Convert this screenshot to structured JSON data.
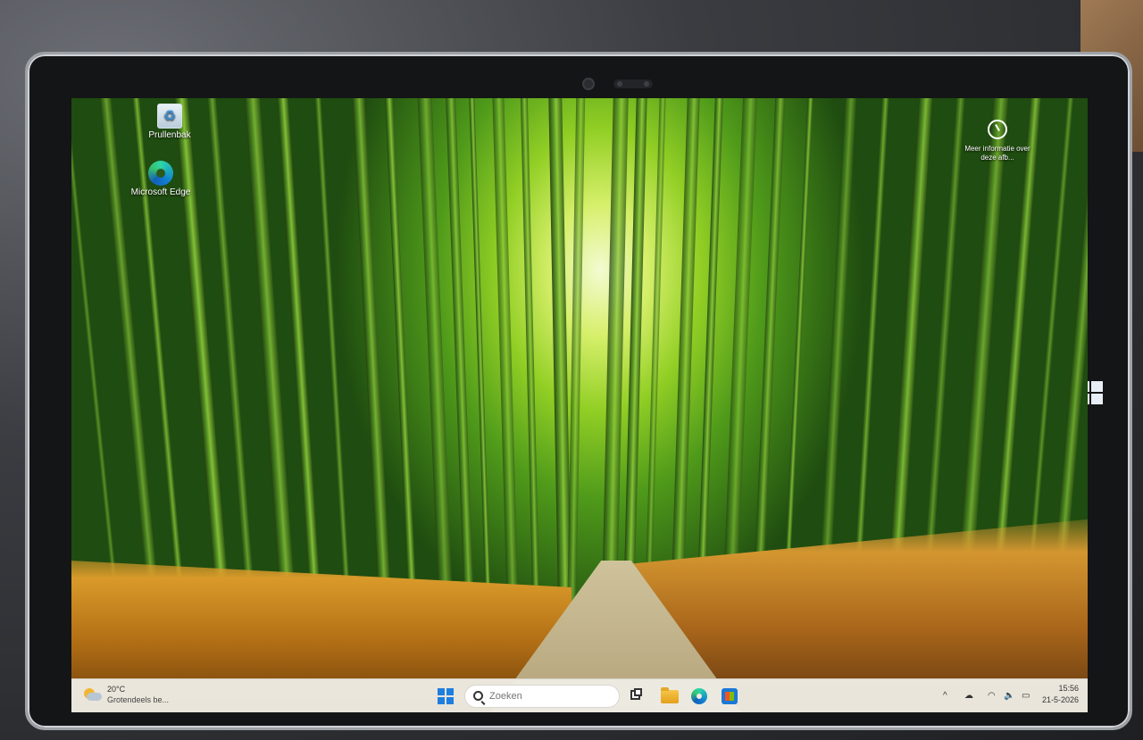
{
  "desktop": {
    "icons": [
      {
        "label": "Prullenbak",
        "icon": "recycle-bin-icon"
      },
      {
        "label": "Microsoft Edge",
        "icon": "edge-icon"
      }
    ],
    "spotlight": {
      "label": "Meer informatie over deze afb...",
      "icon": "spotlight-info-icon"
    }
  },
  "taskbar": {
    "weather": {
      "temperature": "20°C",
      "condition": "Grotendeels be...",
      "icon": "partly-cloudy-icon"
    },
    "search": {
      "placeholder": "Zoeken"
    },
    "apps": [
      {
        "name": "start",
        "icon": "windows-start-icon"
      },
      {
        "name": "task-view",
        "icon": "task-view-icon"
      },
      {
        "name": "file-explorer",
        "icon": "folder-icon"
      },
      {
        "name": "edge",
        "icon": "edge-icon"
      },
      {
        "name": "store",
        "icon": "store-icon"
      }
    ],
    "tray": {
      "chevron": "^",
      "icons": [
        "onedrive-icon",
        "wifi-icon",
        "volume-icon",
        "battery-icon"
      ]
    },
    "clock": {
      "time": "15:56",
      "date": "21-5-2026"
    }
  },
  "colors": {
    "accent": "#1f7fe0",
    "taskbar": "#eeece4"
  }
}
